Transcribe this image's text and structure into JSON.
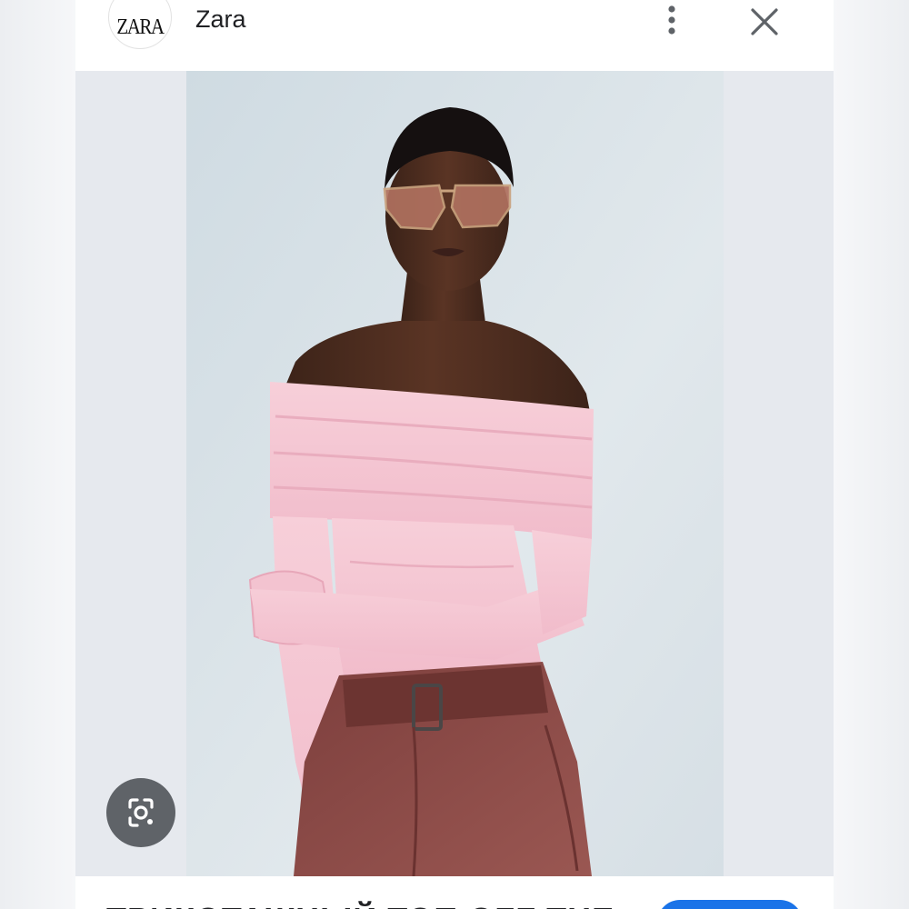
{
  "header": {
    "logo_text": "ZARA",
    "site_name": "Zara"
  },
  "image": {
    "alt": "Woman in pink off-shoulder top and brown belted trousers"
  },
  "footer": {
    "product_title": "ТРИКОТАЖНЫЙ ТОП OFF THE",
    "visit_label": ""
  },
  "icons": {
    "menu": "more-vert-icon",
    "close": "close-icon",
    "lens": "image-search-icon"
  },
  "colors": {
    "accent": "#1a73e8",
    "lens_button": "#5f6368",
    "top_pink": "#f5c6d2",
    "trousers": "#8a4a47",
    "background": "#dfe6ea"
  }
}
